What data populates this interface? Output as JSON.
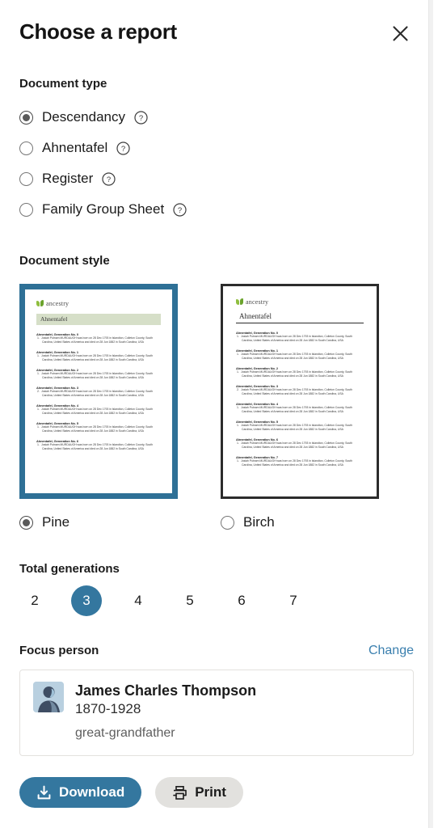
{
  "dialog": {
    "title": "Choose a report",
    "close_icon": "close-icon"
  },
  "document_type": {
    "heading": "Document type",
    "options": [
      {
        "label": "Descendancy",
        "selected": true,
        "help_icon": "help-icon"
      },
      {
        "label": "Ahnentafel",
        "selected": false,
        "help_icon": "help-icon"
      },
      {
        "label": "Register",
        "selected": false,
        "help_icon": "help-icon"
      },
      {
        "label": "Family Group Sheet",
        "selected": false,
        "help_icon": "help-icon"
      }
    ]
  },
  "document_style": {
    "heading": "Document style",
    "options": [
      {
        "label": "Pine",
        "selected": true
      },
      {
        "label": "Birch",
        "selected": false
      }
    ],
    "preview": {
      "brand": "ancestry",
      "doc_title": "Ahnentafel",
      "entries": [
        {
          "heading": "Ahnentafel, Generation No. 0",
          "body": "Josiah Putnam MURDAUGH was born on 28 Dec 1793 in Islandton, Colleton County, South Carolina, United States of America and died on 28 Jun 1882 in South Carolina, USA",
          "num": "1."
        },
        {
          "heading": "Ahnentafel, Generation No. 1",
          "body": "Josiah Putnam MURDAUGH was born on 28 Dec 1793 in Islandton, Colleton County, South Carolina, United States of America and died on 28 Jun 1882 in South Carolina, USA",
          "num": "1."
        },
        {
          "heading": "Ahnentafel, Generation No. 2",
          "body": "Josiah Putnam MURDAUGH was born on 28 Dec 1793 in Islandton, Colleton County, South Carolina, United States of America and died on 28 Jun 1882 in South Carolina, USA",
          "num": "1."
        },
        {
          "heading": "Ahnentafel, Generation No. 3",
          "body": "Josiah Putnam MURDAUGH was born on 28 Dec 1793 in Islandton, Colleton County, South Carolina, United States of America and died on 28 Jun 1882 in South Carolina, USA",
          "num": "2."
        },
        {
          "heading": "Ahnentafel, Generation No. 4",
          "body": "Josiah Putnam MURDAUGH was born on 28 Dec 1793 in Islandton, Colleton County, South Carolina, United States of America and died on 28 Jun 1882 in South Carolina, USA",
          "num": "1."
        },
        {
          "heading": "Ahnentafel, Generation No. 5",
          "body": "Josiah Putnam MURDAUGH was born on 28 Dec 1793 in Islandton, Colleton County, South Carolina, United States of America and died on 28 Jun 1882 in South Carolina, USA",
          "num": "1."
        },
        {
          "heading": "Ahnentafel, Generation No. 6",
          "body": "Josiah Putnam MURDAUGH was born on 28 Dec 1793 in Islandton, Colleton County, South Carolina, United States of America and died on 28 Jun 1882 in South Carolina, USA",
          "num": "1."
        },
        {
          "heading": "Ahnentafel, Generation No. 7",
          "body": "Josiah Putnam MURDAUGH was born on 28 Dec 1793 in Islandton, Colleton County, South Carolina, United States of America and died on 28 Jun 1882 in South Carolina, USA",
          "num": "1."
        }
      ]
    }
  },
  "generations": {
    "heading": "Total generations",
    "options": [
      "2",
      "3",
      "4",
      "5",
      "6",
      "7"
    ],
    "selected": "3"
  },
  "focus_person": {
    "heading": "Focus person",
    "change_label": "Change",
    "name": "James Charles Thompson",
    "years": "1870-1928",
    "relationship": "great-grandfather",
    "avatar_icon": "person-avatar-icon"
  },
  "actions": {
    "download_label": "Download",
    "download_icon": "download-icon",
    "print_label": "Print",
    "print_icon": "print-icon"
  },
  "colors": {
    "accent_blue": "#34779f",
    "link_blue": "#3a7fae",
    "secondary_button": "#e2e1de",
    "pine_border": "#2e7096",
    "birch_border": "#2c2c2c",
    "pine_band": "#d6dfc8"
  }
}
